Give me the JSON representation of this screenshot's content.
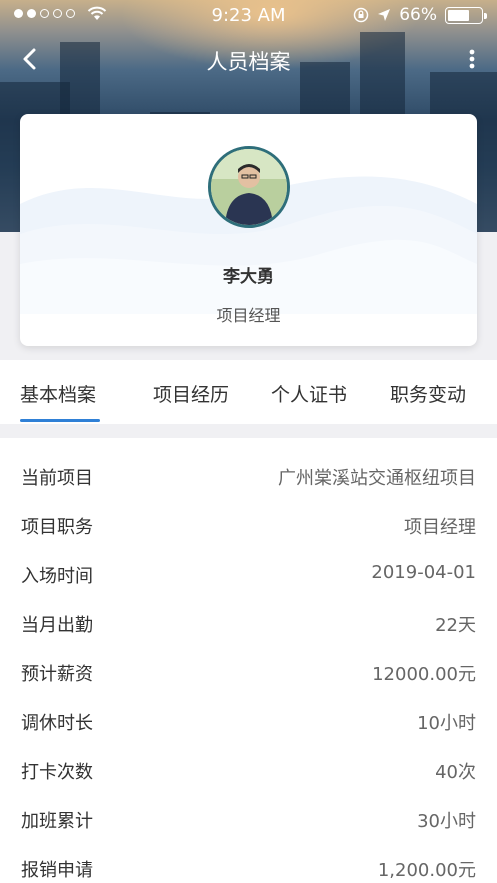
{
  "status_bar": {
    "time": "9:23 AM",
    "battery": "66%",
    "battery_level": 0.66,
    "signal_bars_filled": 2,
    "signal_bars_total": 5
  },
  "nav": {
    "title": "人员档案",
    "back_icon": "chevron-left-icon",
    "more_icon": "more-vertical-icon"
  },
  "profile": {
    "name": "李大勇",
    "title": "项目经理"
  },
  "tabs": [
    {
      "label": "基本档案",
      "active": true
    },
    {
      "label": "项目经历",
      "active": false
    },
    {
      "label": "个人证书",
      "active": false
    },
    {
      "label": "职务变动",
      "active": false
    }
  ],
  "details": [
    {
      "label": "当前项目",
      "value": "广州棠溪站交通枢纽项目"
    },
    {
      "label": "项目职务",
      "value": "项目经理"
    },
    {
      "label": "入场时间",
      "value": "2019-04-01"
    },
    {
      "label": "当月出勤",
      "value": "22天"
    },
    {
      "label": "预计薪资",
      "value": "12000.00元"
    },
    {
      "label": "调休时长",
      "value": "10小时"
    },
    {
      "label": "打卡次数",
      "value": "40次"
    },
    {
      "label": "加班累计",
      "value": "30小时"
    },
    {
      "label": "报销申请",
      "value": "1,200.00元"
    }
  ],
  "colors": {
    "accent": "#2f80d6",
    "text_primary": "#333333",
    "text_secondary": "#666666",
    "page_background": "#f0f0f3"
  }
}
